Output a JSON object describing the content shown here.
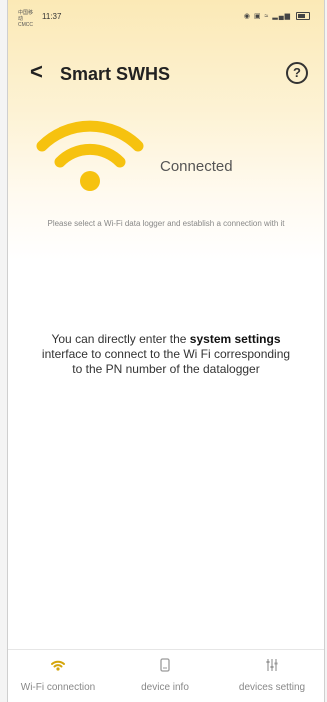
{
  "status_bar": {
    "carrier": "中国移动 CMCC",
    "time": "11:37"
  },
  "header": {
    "title": "Smart SWHS"
  },
  "connection": {
    "status": "Connected",
    "hint": "Please select a Wi-Fi data logger and establish a connection with it"
  },
  "info": {
    "part1": "You can directly enter the ",
    "bold1": "system settings",
    "part2": " interface to connect to the Wi Fi corresponding to the PN number of the datalogger"
  },
  "bottom_nav": {
    "items": [
      {
        "label": "Wi-Fi connection",
        "icon": "wifi-icon"
      },
      {
        "label": "device info",
        "icon": "device-icon"
      },
      {
        "label": "devices setting",
        "icon": "sliders-icon"
      }
    ]
  },
  "colors": {
    "accent": "#f6c20f",
    "header_bg": "#fbe9b6"
  }
}
